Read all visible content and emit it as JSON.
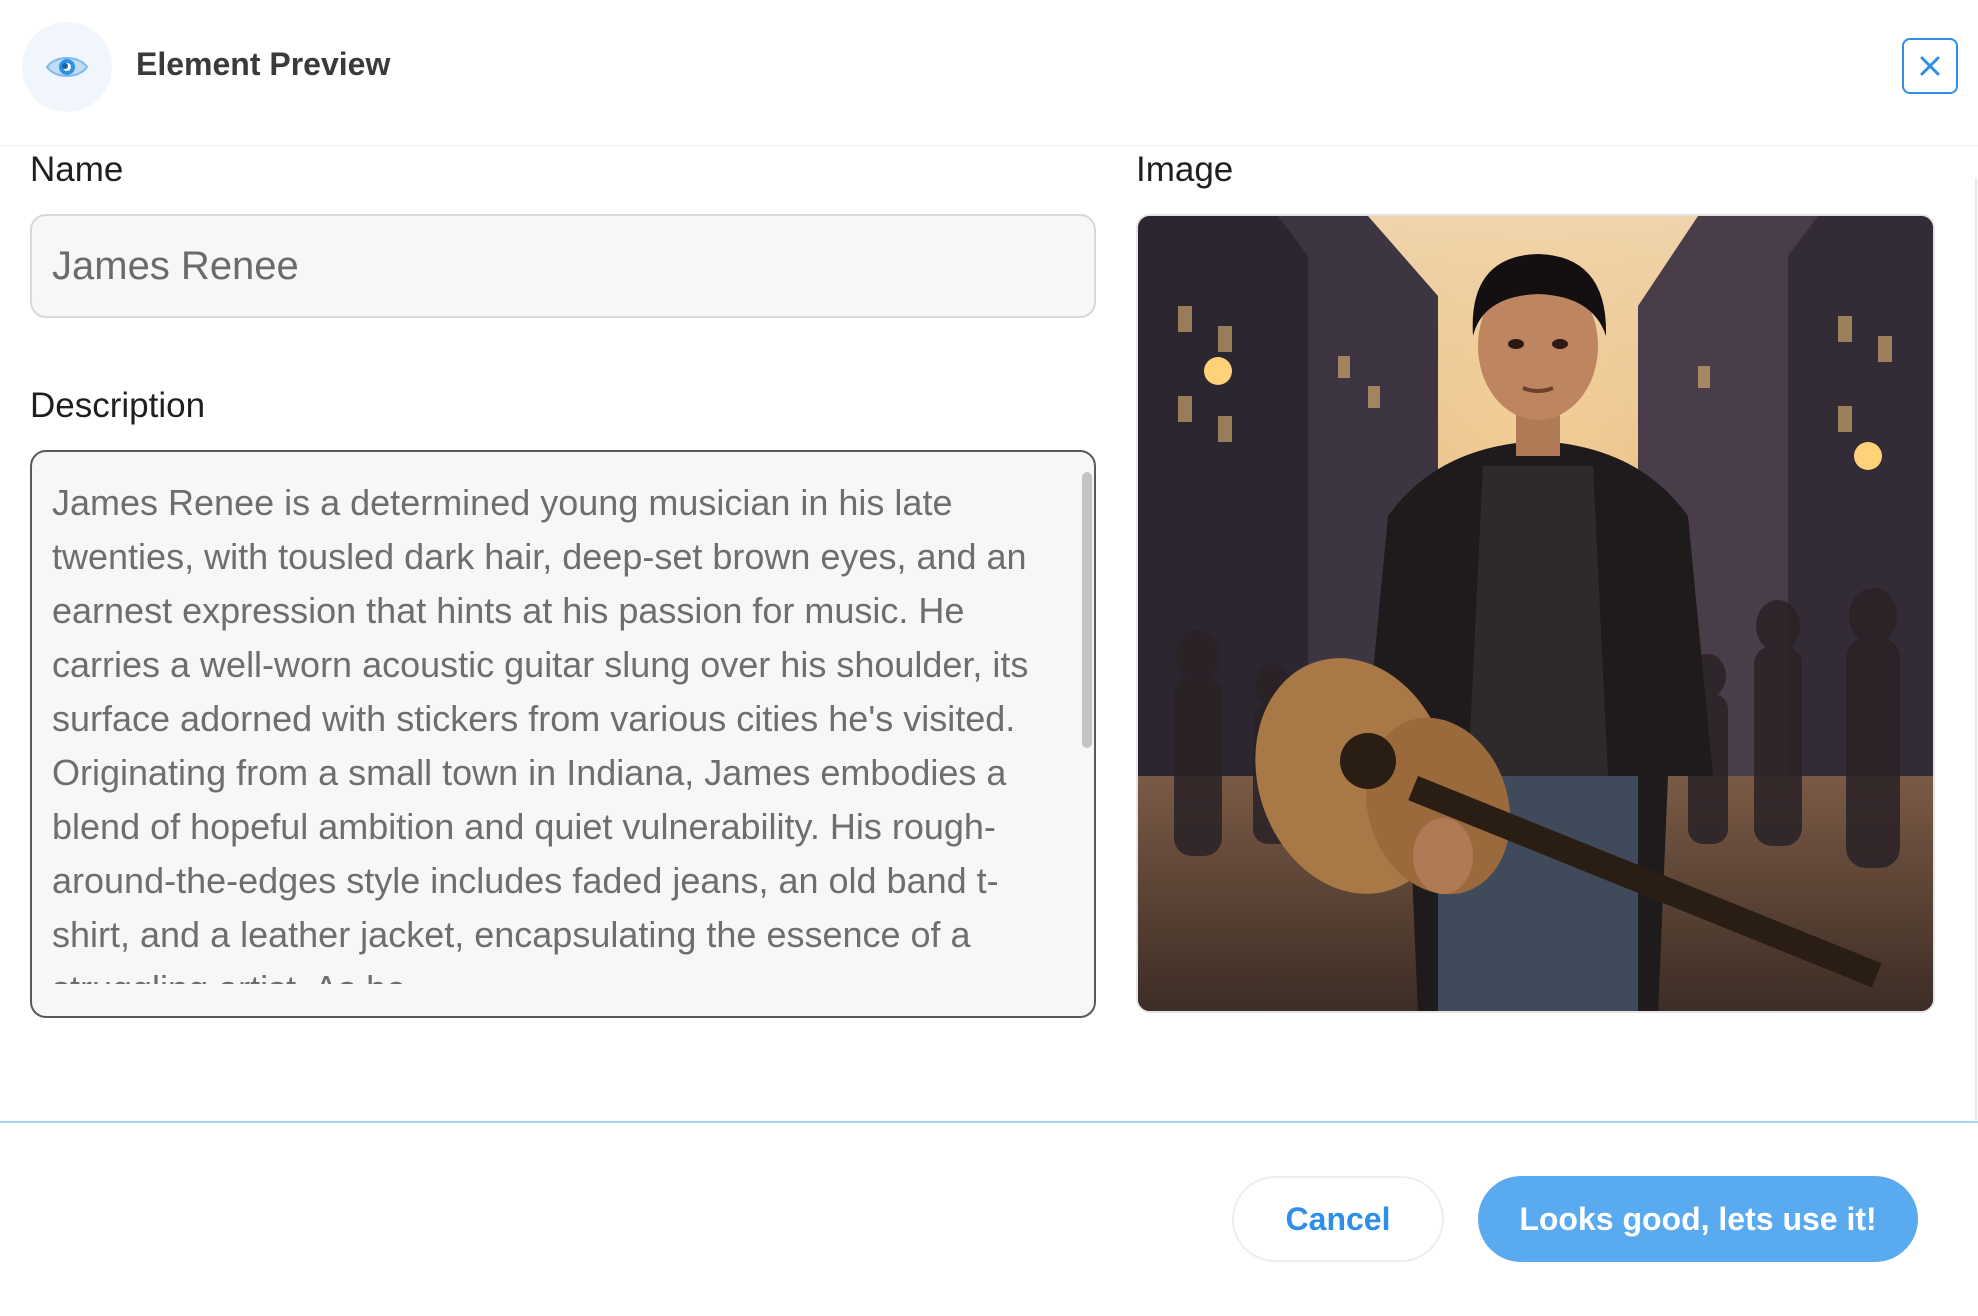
{
  "header": {
    "title": "Element Preview",
    "icon": "eye-icon",
    "close_icon": "close-icon"
  },
  "form": {
    "name_label": "Name",
    "name_value": "James Renee",
    "description_label": "Description",
    "description_value": "James Renee is a determined young musician in his late twenties, with tousled dark hair, deep-set brown eyes, and an earnest expression that hints at his passion for music. He carries a well-worn acoustic guitar slung over his shoulder, its surface adorned with stickers from various cities he's visited. Originating from a small town in Indiana, James embodies a blend of hopeful ambition and quiet vulnerability. His rough-around-the-edges style includes faded jeans, an old band t-shirt, and a leather jacket, encapsulating the essence of a struggling artist. As he",
    "image_label": "Image"
  },
  "footer": {
    "cancel_label": "Cancel",
    "confirm_label": "Looks good, lets use it!"
  },
  "colors": {
    "accent": "#2f8fe6",
    "primary_button": "#5aaaf0",
    "divider": "#a9d1f3"
  }
}
